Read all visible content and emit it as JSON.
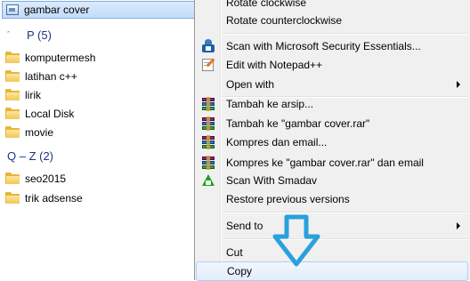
{
  "explorer": {
    "selected_item": {
      "label": "gambar cover",
      "icon": "image-file-icon"
    },
    "groups": [
      {
        "header": "P (5)",
        "items": [
          {
            "label": "komputermesh",
            "icon": "folder-icon"
          },
          {
            "label": "latihan c++",
            "icon": "folder-icon"
          },
          {
            "label": "lirik",
            "icon": "folder-icon"
          },
          {
            "label": "Local Disk",
            "icon": "folder-icon"
          },
          {
            "label": "movie",
            "icon": "folder-icon"
          }
        ]
      },
      {
        "header": "Q – Z (2)",
        "items": [
          {
            "label": "seo2015",
            "icon": "folder-icon"
          },
          {
            "label": "trik adsense",
            "icon": "folder-icon"
          }
        ]
      }
    ]
  },
  "context_menu": {
    "items": [
      {
        "label": "Rotate clockwise"
      },
      {
        "label": "Rotate counterclockwise"
      },
      {
        "label": "Scan with Microsoft Security Essentials...",
        "icon": "microsoft-security-essentials-icon"
      },
      {
        "label": "Edit with Notepad++",
        "icon": "notepad-plus-plus-icon"
      },
      {
        "label": "Open with",
        "submenu": true
      },
      {
        "label": "Tambah ke arsip...",
        "icon": "winrar-icon"
      },
      {
        "label": "Tambah ke \"gambar cover.rar\"",
        "icon": "winrar-icon"
      },
      {
        "label": "Kompres dan email...",
        "icon": "winrar-icon"
      },
      {
        "label": "Kompres ke \"gambar cover.rar\" dan email",
        "icon": "winrar-icon"
      },
      {
        "label": "Scan With Smadav",
        "icon": "smadav-icon"
      },
      {
        "label": "Restore previous versions"
      },
      {
        "label": "Send to",
        "submenu": true
      },
      {
        "label": "Cut"
      },
      {
        "label": "Copy",
        "highlighted": true
      }
    ]
  },
  "annotation": {
    "icon": "down-arrow-icon",
    "color": "#2aa1dc"
  }
}
